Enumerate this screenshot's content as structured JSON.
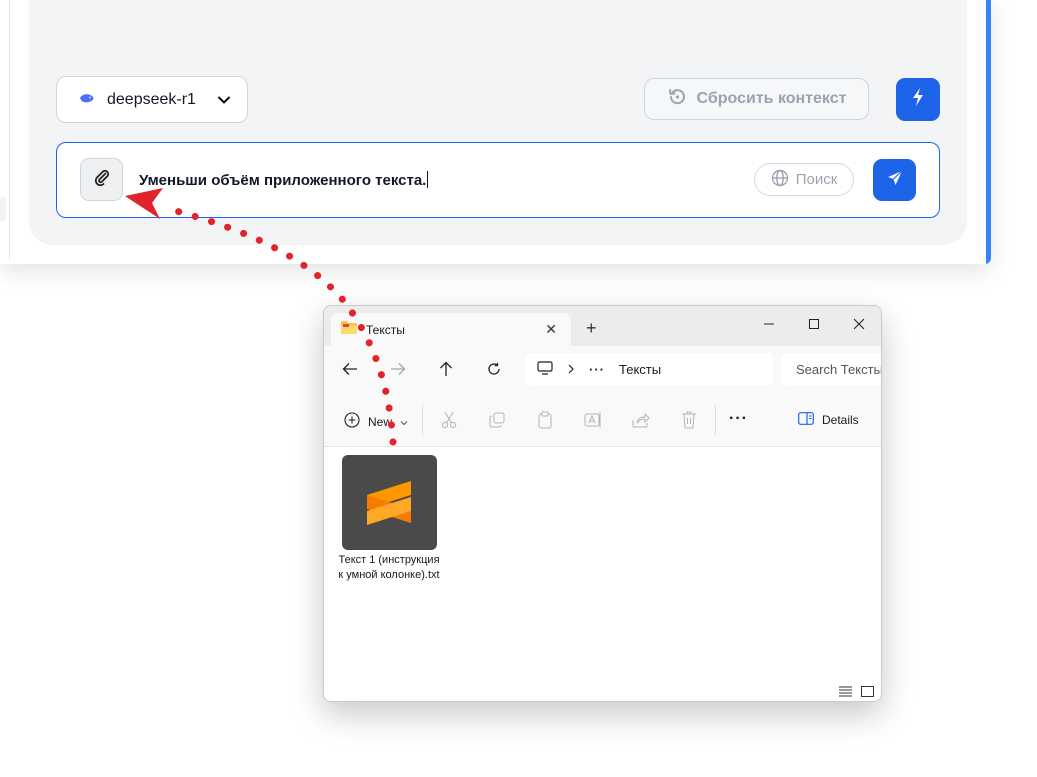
{
  "chat": {
    "model_name": "deepseek-r1",
    "reset_label": "Сбросить контекст",
    "prompt_text": "Уменьши объём приложенного текста.",
    "search_label": "Поиск"
  },
  "explorer": {
    "tab_title": "Тексты",
    "breadcrumb_ellipsis": "···",
    "breadcrumb_current": "Тексты",
    "search_placeholder": "Search Тексты",
    "toolbar": {
      "new_label": "New",
      "more_label": "···",
      "details_label": "Details"
    },
    "files": [
      {
        "name": "Текст 1 (инструкция к умной колонке).txt",
        "icon": "sublime-text-icon"
      }
    ]
  },
  "colors": {
    "accent_blue": "#1d64e8",
    "annotation_red": "#e0242b",
    "folder_yellow": "#f6c64a",
    "sublime_orange": "#f89c1c"
  }
}
